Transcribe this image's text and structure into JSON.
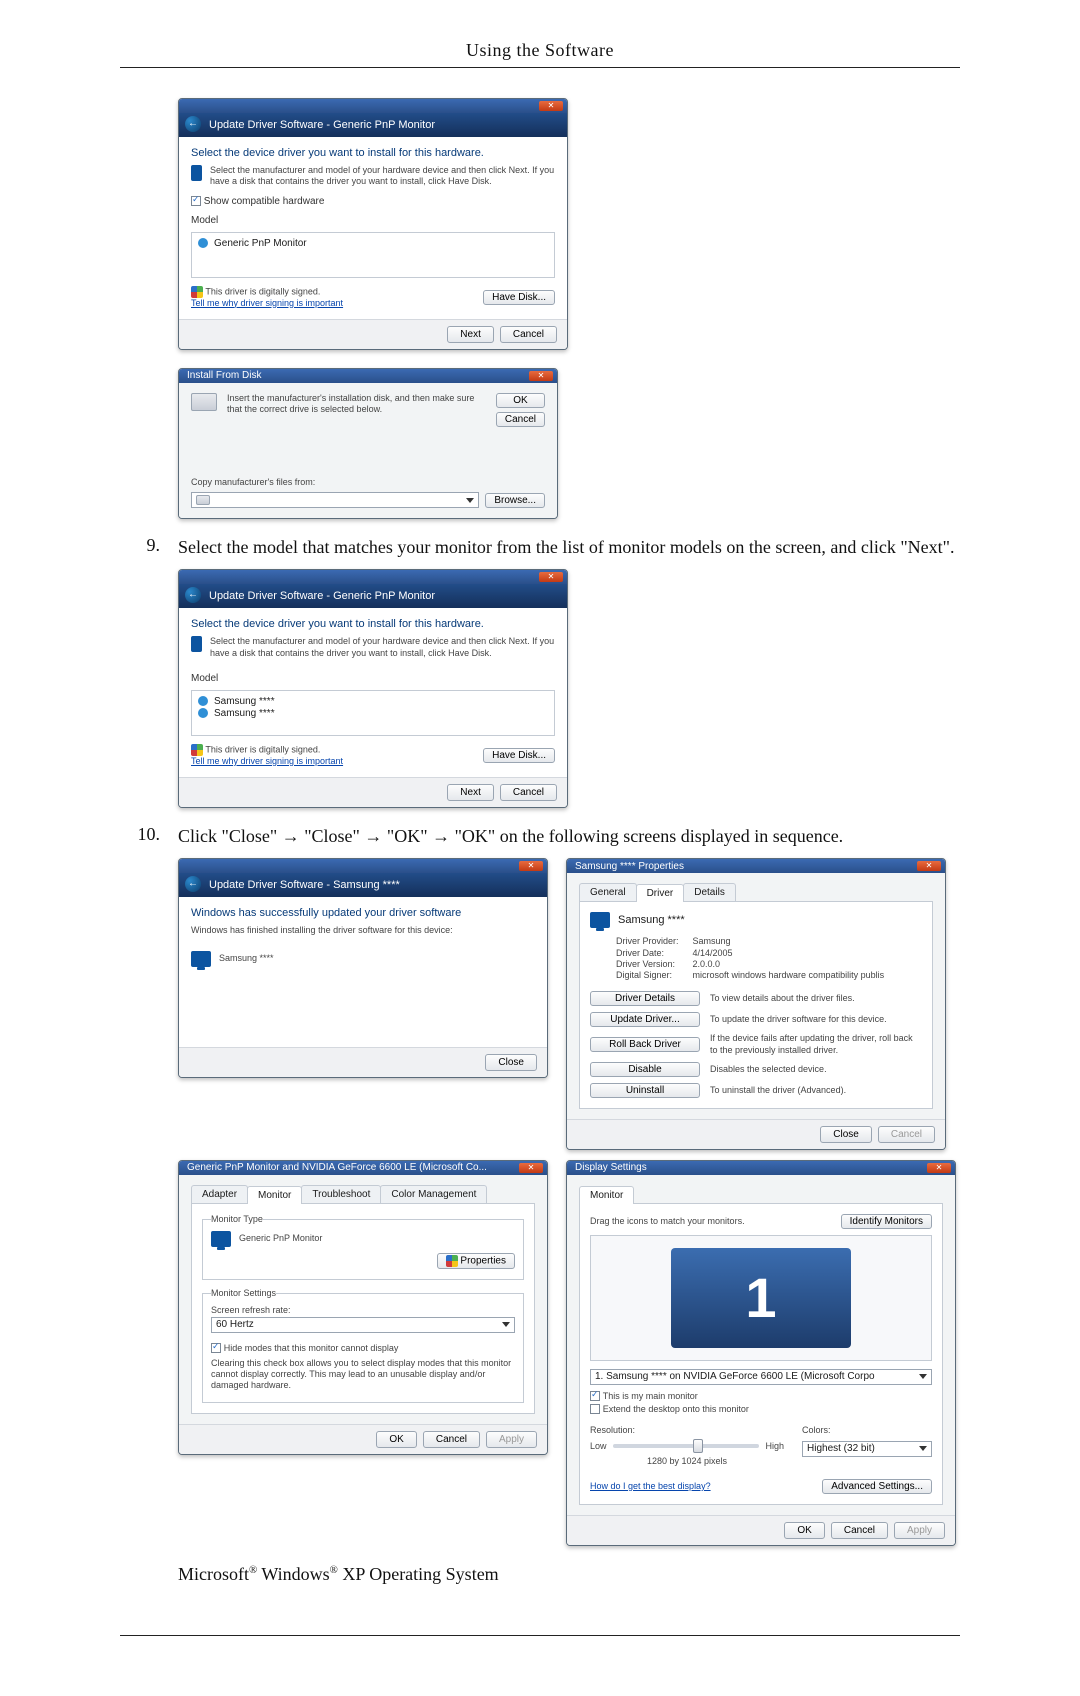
{
  "page_header": "Using the Software",
  "step9_num": "9.",
  "step9_text": "Select the model that matches your monitor from the list of monitor models on the screen, and click \"Next\".",
  "step10_num": "10.",
  "step10_text": "Click \"Close\" → \"Close\" → \"OK\" → \"OK\" on the following screens displayed in sequence.",
  "footer_prefix": "Microsoft",
  "footer_mid": " Windows",
  "footer_suffix": " XP Operating System",
  "reg": "®",
  "win_update1": {
    "breadcrumb": "Update Driver Software - Generic PnP Monitor",
    "heading": "Select the device driver you want to install for this hardware.",
    "desc": "Select the manufacturer and model of your hardware device and then click Next. If you have a disk that contains the driver you want to install, click Have Disk.",
    "chk_label": "Show compatible hardware",
    "model_hdr": "Model",
    "model_row": "Generic PnP Monitor",
    "signed": "This driver is digitally signed.",
    "tell_me": "Tell me why driver signing is important",
    "have_disk": "Have Disk...",
    "next": "Next",
    "cancel": "Cancel"
  },
  "win_ifd": {
    "title": "Install From Disk",
    "desc": "Insert the manufacturer's installation disk, and then make sure that the correct drive is selected below.",
    "ok": "OK",
    "cancel": "Cancel",
    "copy_label": "Copy manufacturer's files from:",
    "browse": "Browse..."
  },
  "win_update2": {
    "breadcrumb": "Update Driver Software - Generic PnP Monitor",
    "heading": "Select the device driver you want to install for this hardware.",
    "desc": "Select the manufacturer and model of your hardware device and then click Next. If you have a disk that contains the driver you want to install, click Have Disk.",
    "model_hdr": "Model",
    "row1": "Samsung ****",
    "row2": "Samsung ****",
    "signed": "This driver is digitally signed.",
    "tell_me": "Tell me why driver signing is important",
    "have_disk": "Have Disk...",
    "next": "Next",
    "cancel": "Cancel"
  },
  "win_success": {
    "breadcrumb": "Update Driver Software - Samsung ****",
    "heading": "Windows has successfully updated your driver software",
    "line2": "Windows has finished installing the driver software for this device:",
    "device": "Samsung ****",
    "close": "Close"
  },
  "win_props": {
    "title": "Samsung **** Properties",
    "tab_general": "General",
    "tab_driver": "Driver",
    "tab_details": "Details",
    "dev_name": "Samsung ****",
    "l_provider": "Driver Provider:",
    "v_provider": "Samsung",
    "l_date": "Driver Date:",
    "v_date": "4/14/2005",
    "l_version": "Driver Version:",
    "v_version": "2.0.0.0",
    "l_signer": "Digital Signer:",
    "v_signer": "microsoft windows hardware compatibility publis",
    "btn_details": "Driver Details",
    "txt_details": "To view details about the driver files.",
    "btn_update": "Update Driver...",
    "txt_update": "To update the driver software for this device.",
    "btn_rollback": "Roll Back Driver",
    "txt_rollback": "If the device fails after updating the driver, roll back to the previously installed driver.",
    "btn_disable": "Disable",
    "txt_disable": "Disables the selected device.",
    "btn_uninstall": "Uninstall",
    "txt_uninstall": "To uninstall the driver (Advanced).",
    "close": "Close",
    "cancel": "Cancel"
  },
  "win_genmon": {
    "title": "Generic PnP Monitor and NVIDIA GeForce 6600 LE (Microsoft Co...",
    "tab_adapter": "Adapter",
    "tab_monitor": "Monitor",
    "tab_tshoot": "Troubleshoot",
    "tab_color": "Color Management",
    "grp_type": "Monitor Type",
    "type_val": "Generic PnP Monitor",
    "btn_props": "Properties",
    "grp_settings": "Monitor Settings",
    "lbl_refresh": "Screen refresh rate:",
    "refresh_val": "60 Hertz",
    "chk_hide": "Hide modes that this monitor cannot display",
    "hide_desc": "Clearing this check box allows you to select display modes that this monitor cannot display correctly. This may lead to an unusable display and/or damaged hardware.",
    "ok": "OK",
    "cancel": "Cancel",
    "apply": "Apply"
  },
  "win_disp": {
    "title": "Display Settings",
    "tab_monitor": "Monitor",
    "drag": "Drag the icons to match your monitors.",
    "identify": "Identify Monitors",
    "select_val": "1. Samsung **** on NVIDIA GeForce 6600 LE (Microsoft Corpo",
    "chk_main": "This is my main monitor",
    "chk_extend": "Extend the desktop onto this monitor",
    "lbl_res": "Resolution:",
    "lbl_colors": "Colors:",
    "res_low": "Low",
    "res_high": "High",
    "res_val": "1280 by 1024 pixels",
    "colors_val": "Highest (32 bit)",
    "best": "How do I get the best display?",
    "adv": "Advanced Settings...",
    "ok": "OK",
    "cancel": "Cancel",
    "apply": "Apply"
  }
}
